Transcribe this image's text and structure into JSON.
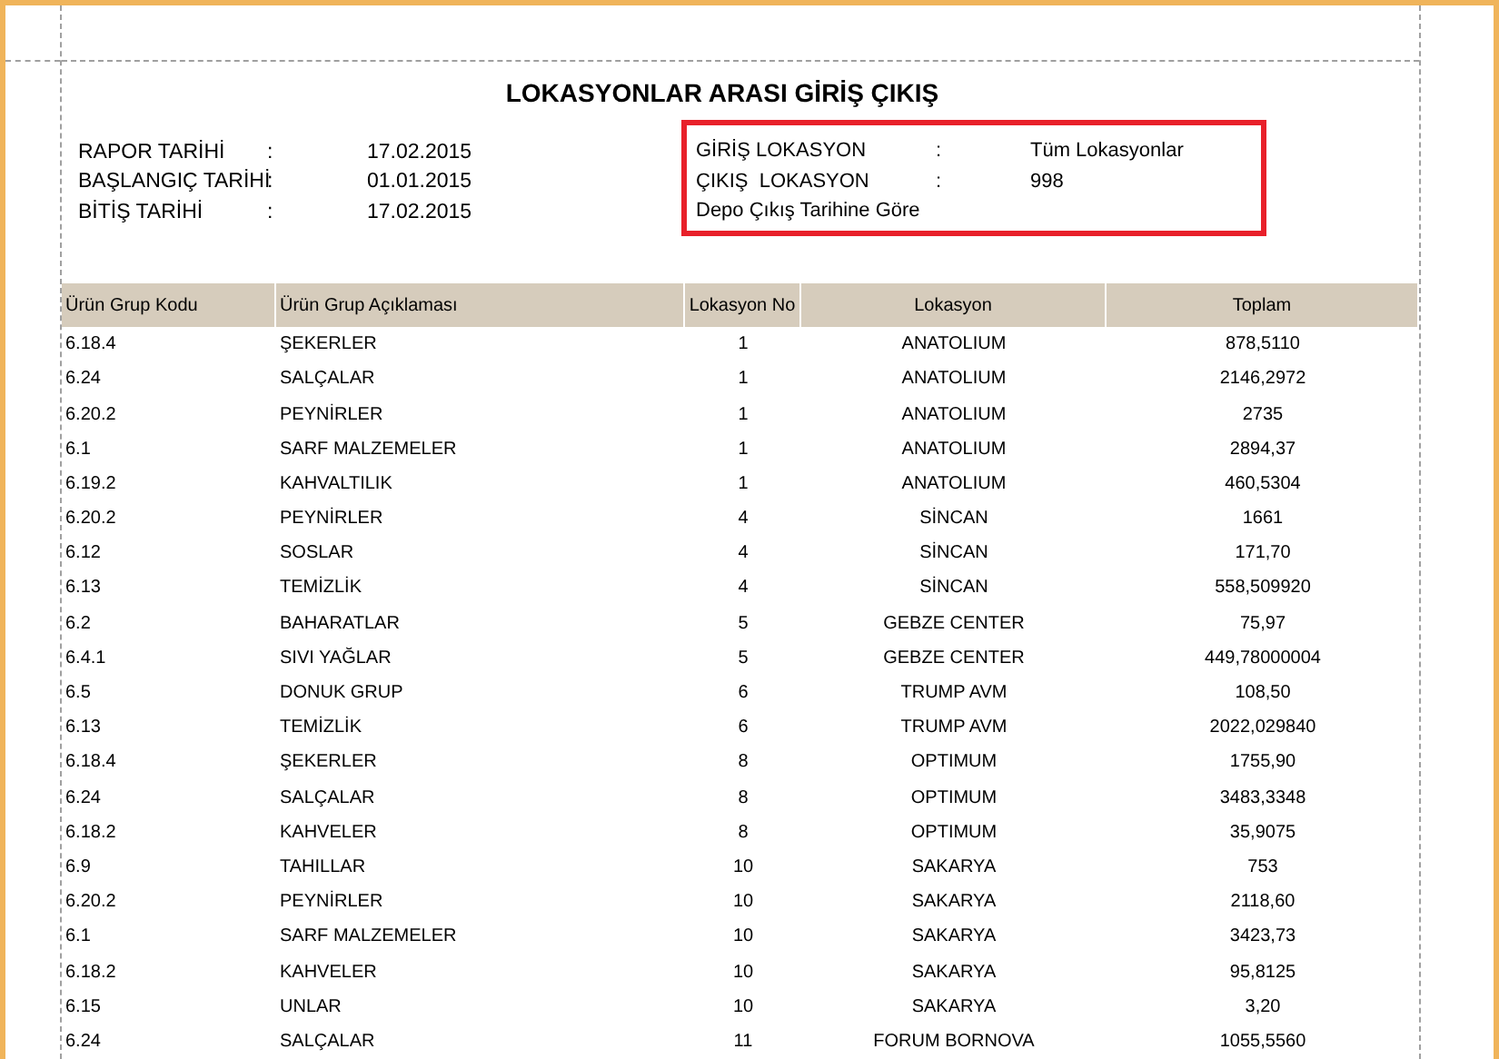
{
  "report": {
    "title": "LOKASYONLAR ARASI GİRİŞ ÇIKIŞ",
    "left_info": [
      {
        "label": "RAPOR TARİHİ",
        "separator": ":",
        "value": "17.02.2015"
      },
      {
        "label": "BAŞLANGIÇ TARİHİ",
        "separator": ":",
        "value": "01.01.2015"
      },
      {
        "label": "BİTİŞ TARİHİ",
        "separator": ":",
        "value": "17.02.2015"
      }
    ],
    "right_info": [
      {
        "label": "GİRİŞ LOKASYON",
        "separator": ":",
        "value": "Tüm Lokasyonlar"
      },
      {
        "label": "ÇIKIŞ  LOKASYON",
        "separator": ":",
        "value": "998"
      }
    ],
    "right_note": "Depo Çıkış Tarihine Göre"
  },
  "table": {
    "columns": [
      "Ürün Grup Kodu",
      "Ürün Grup Açıklaması",
      "Lokasyon No",
      "Lokasyon",
      "Toplam"
    ],
    "rows": [
      [
        "6.18.4",
        "ŞEKERLER",
        "1",
        "ANATOLIUM",
        "878,5110"
      ],
      [
        "6.24",
        "SALÇALAR",
        "1",
        "ANATOLIUM",
        "2146,2972"
      ],
      [
        "6.20.2",
        "PEYNİRLER",
        "1",
        "ANATOLIUM",
        "2735"
      ],
      [
        "6.1",
        "SARF MALZEMELER",
        "1",
        "ANATOLIUM",
        "2894,37"
      ],
      [
        "6.19.2",
        "KAHVALTILIK",
        "1",
        "ANATOLIUM",
        "460,5304"
      ],
      [
        "6.20.2",
        "PEYNİRLER",
        "4",
        "SİNCAN",
        "1661"
      ],
      [
        "6.12",
        "SOSLAR",
        "4",
        "SİNCAN",
        "171,70"
      ],
      [
        "6.13",
        "TEMİZLİK",
        "4",
        "SİNCAN",
        "558,509920"
      ],
      [
        "6.2",
        "BAHARATLAR",
        "5",
        "GEBZE CENTER",
        "75,97"
      ],
      [
        "6.4.1",
        "SIVI YAĞLAR",
        "5",
        "GEBZE CENTER",
        "449,78000004"
      ],
      [
        "6.5",
        "DONUK GRUP",
        "6",
        "TRUMP AVM",
        "108,50"
      ],
      [
        "6.13",
        "TEMİZLİK",
        "6",
        "TRUMP AVM",
        "2022,029840"
      ],
      [
        "6.18.4",
        "ŞEKERLER",
        "8",
        "OPTIMUM",
        "1755,90"
      ],
      [
        "6.24",
        "SALÇALAR",
        "8",
        "OPTIMUM",
        "3483,3348"
      ],
      [
        "6.18.2",
        "KAHVELER",
        "8",
        "OPTIMUM",
        "35,9075"
      ],
      [
        "6.9",
        "TAHILLAR",
        "10",
        "SAKARYA",
        "753"
      ],
      [
        "6.20.2",
        "PEYNİRLER",
        "10",
        "SAKARYA",
        "2118,60"
      ],
      [
        "6.1",
        "SARF MALZEMELER",
        "10",
        "SAKARYA",
        "3423,73"
      ],
      [
        "6.18.2",
        "KAHVELER",
        "10",
        "SAKARYA",
        "95,8125"
      ],
      [
        "6.15",
        "UNLAR",
        "10",
        "SAKARYA",
        "3,20"
      ],
      [
        "6.24",
        "SALÇALAR",
        "11",
        "FORUM BORNOVA",
        "1055,5560"
      ]
    ]
  }
}
